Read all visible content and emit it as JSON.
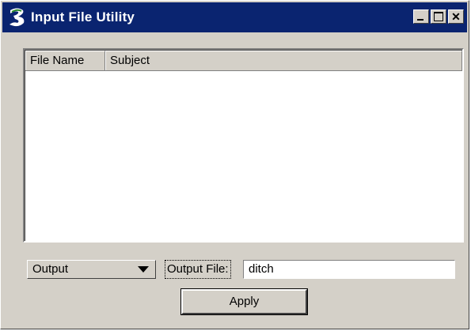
{
  "window": {
    "title": "Input File Utility",
    "accent": "#0a2470"
  },
  "titlebar_buttons": [
    {
      "name": "minimize",
      "icon": "minimize-icon"
    },
    {
      "name": "maximize",
      "icon": "maximize-icon"
    },
    {
      "name": "close",
      "icon": "close-icon",
      "glyph": "✕"
    }
  ],
  "list": {
    "columns": [
      "File Name",
      "Subject"
    ],
    "rows": []
  },
  "mode_dropdown": {
    "selected": "Output"
  },
  "output_file": {
    "label": "Output File:",
    "value": "ditch"
  },
  "apply_button": {
    "label": "Apply"
  }
}
